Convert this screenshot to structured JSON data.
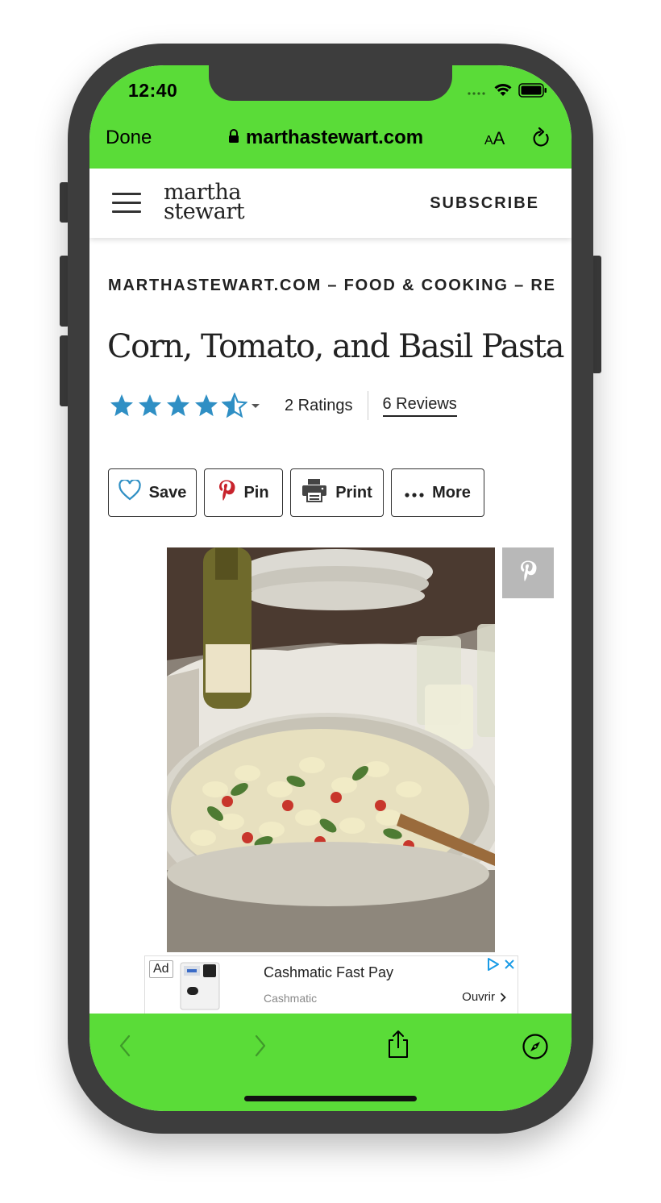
{
  "status_bar": {
    "time": "12:40"
  },
  "browser": {
    "done_label": "Done",
    "url": "marthastewart.com",
    "text_size_label": "AA"
  },
  "site": {
    "logo_line1": "martha",
    "logo_line2": "stewart",
    "subscribe_label": "SUBSCRIBE"
  },
  "article": {
    "breadcrumb": "MARTHASTEWART.COM  –  FOOD & COOKING  –  RE",
    "title": "Corn, Tomato, and Basil Pasta",
    "rating_value": 4.5,
    "ratings_label": "2 Ratings",
    "reviews_label": "6 Reviews"
  },
  "actions": [
    {
      "label": "Save",
      "icon": "heart-icon"
    },
    {
      "label": "Pin",
      "icon": "pinterest-icon"
    },
    {
      "label": "Print",
      "icon": "printer-icon"
    },
    {
      "label": "More",
      "icon": "more-dots-icon"
    }
  ],
  "ad": {
    "badge": "Ad",
    "title": "Cashmatic Fast Pay",
    "sponsor": "Cashmatic",
    "open_label": "Ouvrir"
  },
  "colors": {
    "browser_chrome": "#5adc38",
    "star_blue": "#2f8fc4",
    "pinterest_red": "#c8232c"
  }
}
